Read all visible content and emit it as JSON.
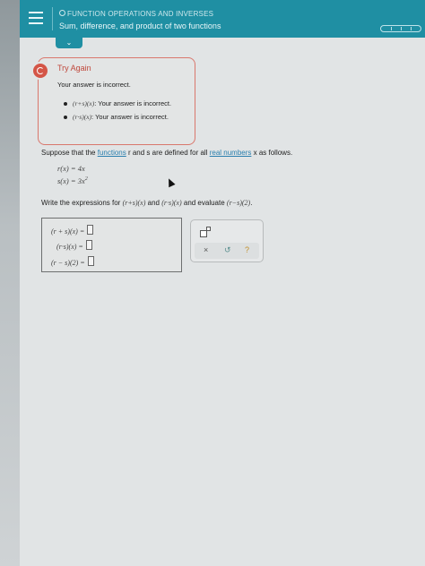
{
  "header": {
    "topic": "FUNCTION OPERATIONS AND INVERSES",
    "subtitle": "Sum, difference, and product of two functions"
  },
  "feedback": {
    "title": "Try Again",
    "message": "Your answer is incorrect.",
    "items": [
      {
        "expr": "(r+s)(x)",
        "text": ": Your answer is incorrect."
      },
      {
        "expr": "(r·s)(x)",
        "text": ": Your answer is incorrect."
      }
    ]
  },
  "problem": {
    "prefix": "Suppose that the ",
    "link_functions": "functions",
    "mid1": " r and s are defined for all ",
    "link_real": "real numbers",
    "suffix": " x as follows.",
    "def_r": "r(x) = 4x",
    "def_s_base": "s(x) = 3x",
    "def_s_exp": "2",
    "instruction_prefix": "Write the expressions for ",
    "instr_expr1": "(r+s)(x)",
    "instr_and": " and ",
    "instr_expr2": "(r·s)(x)",
    "instr_mid": " and evaluate ",
    "instr_expr3": "(r−s)(2)",
    "instr_end": "."
  },
  "answers": [
    {
      "label": "(r + s)(x) =",
      "value": ""
    },
    {
      "label": "(r·s)(x) =",
      "value": ""
    },
    {
      "label": "(r − s)(2) =",
      "value": ""
    }
  ],
  "tools": {
    "clear": "×",
    "undo": "↺",
    "help": "?"
  },
  "nav": {
    "chevron": "⌄"
  }
}
